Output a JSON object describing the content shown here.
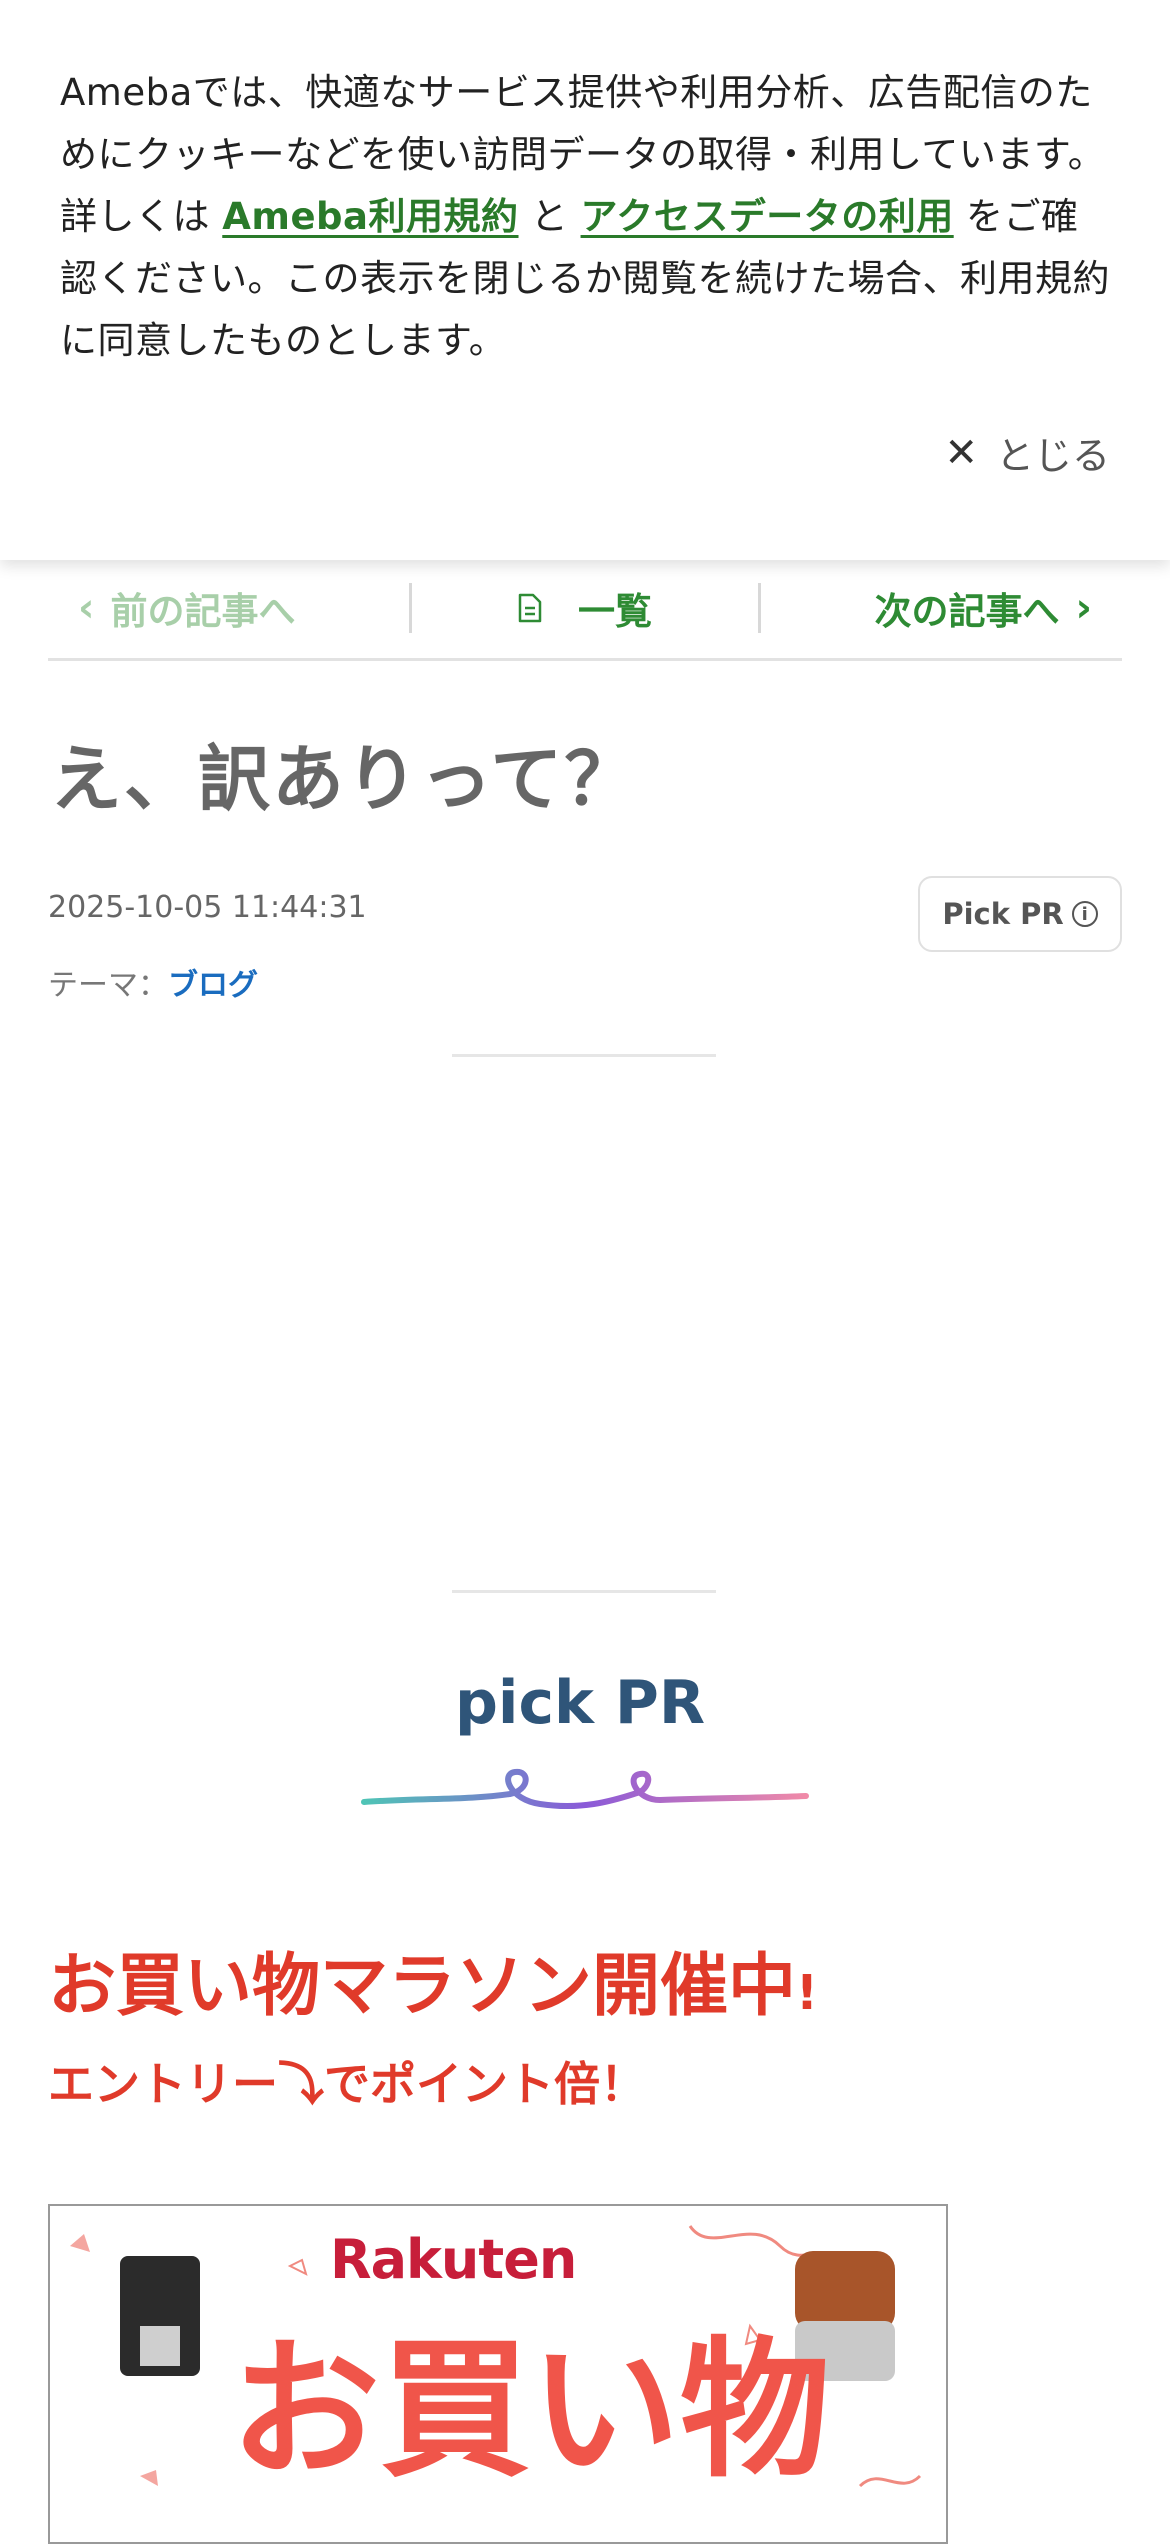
{
  "cookie": {
    "text_before": "Amebaでは、快適なサービス提供や利用分析、広告配信のためにクッキーなどを使い訪問データの取得・利用しています。詳しくは ",
    "link1": "Ameba利用規約",
    "between": " と ",
    "link2": "アクセスデータの利用",
    "text_after": " をご確認ください。この表示を閉じるか閲覧を続けた場合、利用規約に同意したものとします。",
    "close_label": "とじる"
  },
  "nav": {
    "prev": "前の記事へ",
    "list": "一覧",
    "next": "次の記事へ"
  },
  "article": {
    "title": "え、訳ありって？",
    "datetime": "2025-10-05 11:44:31",
    "theme_label": "テーマ：",
    "theme_value": "ブログ",
    "pick_button": "Pick PR"
  },
  "pick": {
    "heading": "pick PR"
  },
  "promo": {
    "headline": "お買い物マラソン開催中",
    "headline_mark": "!",
    "subline": "エントリー⤵でポイント倍！"
  },
  "banner": {
    "brand": "Rakuten",
    "big_text": "お買い物"
  },
  "colors": {
    "accent_green": "#2e8b34",
    "link_blue": "#1a6cbf",
    "promo_red": "#e03a2a",
    "pick_navy": "#2f5579"
  }
}
